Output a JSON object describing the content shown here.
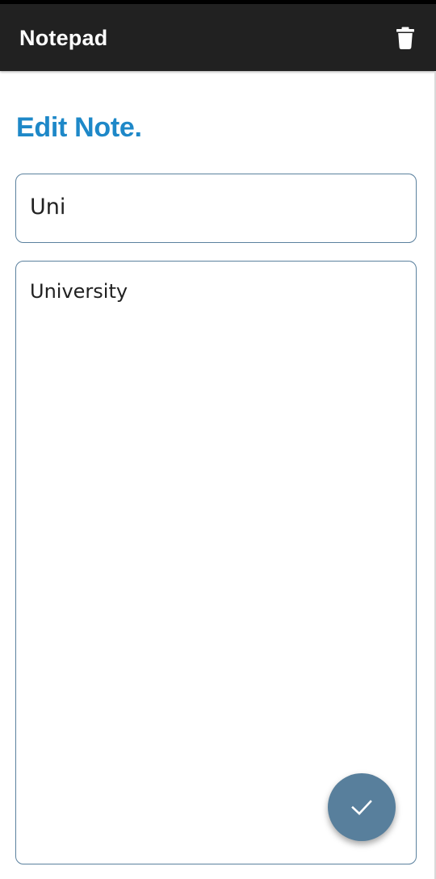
{
  "app_bar": {
    "title": "Notepad",
    "delete_icon": "trash-icon",
    "background_color": "#212121"
  },
  "page": {
    "heading": "Edit Note.",
    "heading_color": "#1e88c8"
  },
  "form": {
    "title_value": "Uni",
    "body_value": "University",
    "border_color": "#5b819e"
  },
  "fab": {
    "icon": "checkmark-icon",
    "color": "#587f9c"
  }
}
